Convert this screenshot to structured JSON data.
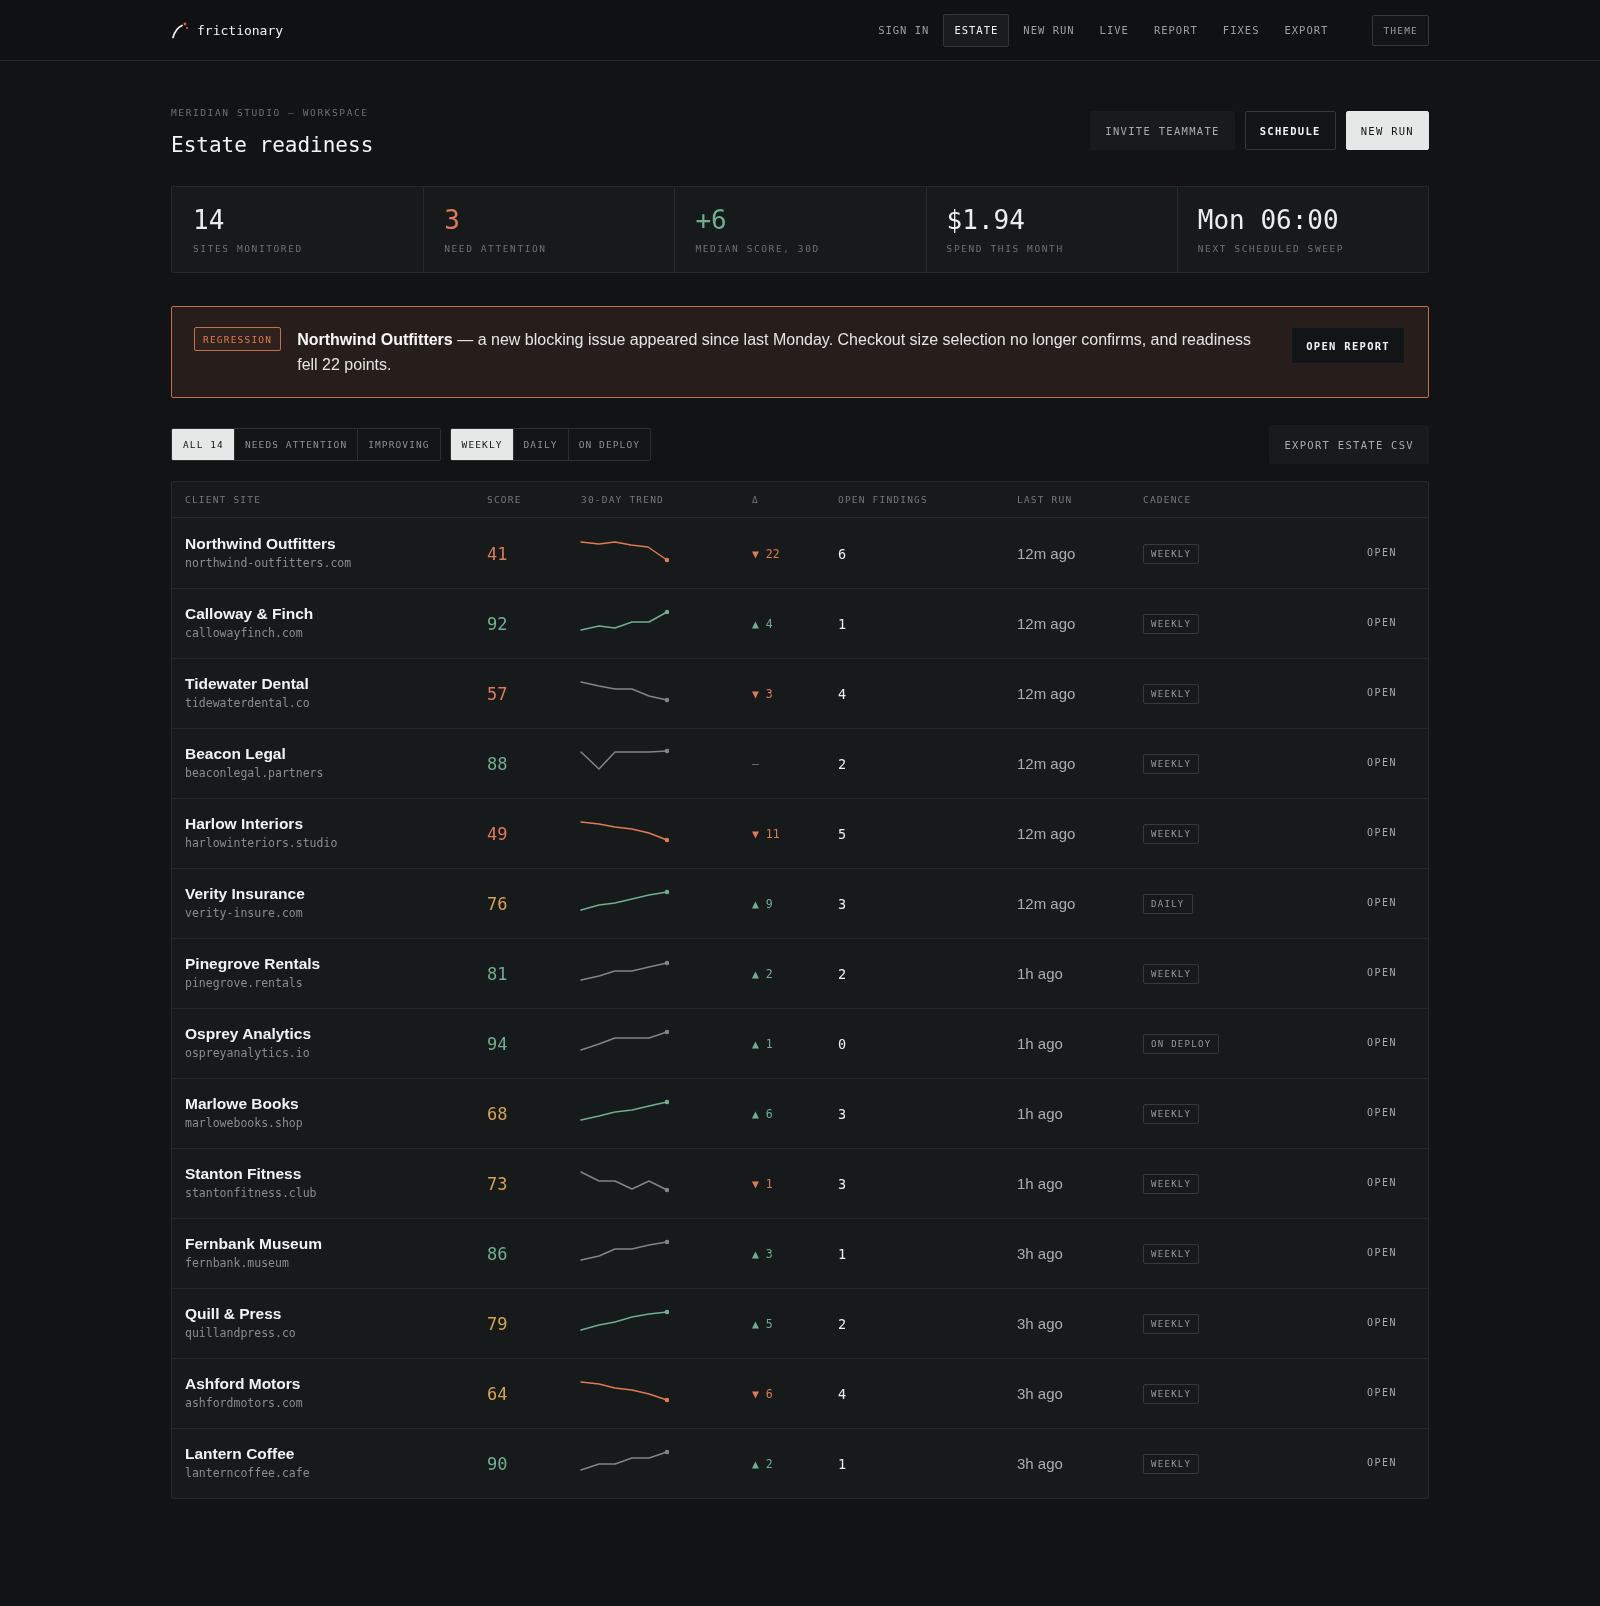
{
  "brand": {
    "name": "frictionary"
  },
  "nav": {
    "items": [
      {
        "label": "SIGN IN",
        "selected": false
      },
      {
        "label": "ESTATE",
        "selected": true
      },
      {
        "label": "NEW RUN",
        "selected": false
      },
      {
        "label": "LIVE",
        "selected": false
      },
      {
        "label": "REPORT",
        "selected": false
      },
      {
        "label": "FIXES",
        "selected": false
      },
      {
        "label": "EXPORT",
        "selected": false
      }
    ],
    "theme_button": "THEME"
  },
  "page": {
    "breadcrumb": "MERIDIAN STUDIO — WORKSPACE",
    "title": "Estate readiness",
    "actions": [
      {
        "label": "INVITE TEAMMATE",
        "kind": "subtle"
      },
      {
        "label": "SCHEDULE",
        "kind": "outline"
      },
      {
        "label": "NEW RUN",
        "kind": "primary"
      }
    ]
  },
  "stats": [
    {
      "value": "14",
      "label": "SITES MONITORED",
      "color": "#eceeed"
    },
    {
      "value": "3",
      "label": "NEED ATTENTION",
      "color": "#e07a52"
    },
    {
      "value": "+6",
      "label": "MEDIAN SCORE, 30D",
      "color": "#6fae8f"
    },
    {
      "value": "$1.94",
      "label": "SPEND THIS MONTH",
      "color": "#eceeed"
    },
    {
      "value": "Mon 06:00",
      "label": "NEXT SCHEDULED SWEEP",
      "color": "#eceeed"
    }
  ],
  "alert": {
    "badge": "REGRESSION",
    "message": "**Northwind Outfitters** — a new blocking issue appeared since last Monday. Checkout size selection no longer confirms, and readiness fell 22 points.",
    "action": "OPEN REPORT"
  },
  "status_filters": [
    {
      "label": "ALL 14",
      "selected": true
    },
    {
      "label": "NEEDS ATTENTION",
      "selected": false
    },
    {
      "label": "IMPROVING",
      "selected": false
    }
  ],
  "cadence_filters": [
    {
      "label": "WEEKLY",
      "selected": true
    },
    {
      "label": "DAILY",
      "selected": false
    },
    {
      "label": "ON DEPLOY",
      "selected": false
    }
  ],
  "export_button": "EXPORT ESTATE CSV",
  "table": {
    "columns": [
      "CLIENT SITE",
      "SCORE",
      "30-DAY TREND",
      "Δ",
      "OPEN FINDINGS",
      "LAST RUN",
      "CADENCE"
    ],
    "rows": [
      {
        "name": "Northwind Outfitters",
        "domain": "northwind-outfitters.com",
        "score": {
          "value": "41",
          "color": "#e07a52"
        },
        "trend": {
          "color": "#e07a52"
        },
        "delta": {
          "value": "▼ 22",
          "color": "#e07a52"
        },
        "open_findings": "6",
        "last_run": "12m ago",
        "cadence": "WEEKLY",
        "action": "OPEN"
      },
      {
        "name": "Calloway & Finch",
        "domain": "callowayfinch.com",
        "score": {
          "value": "92",
          "color": "#6fae8f"
        },
        "trend": {
          "color": "#6fae8f"
        },
        "delta": {
          "value": "▲ 4",
          "color": "#6fae8f"
        },
        "open_findings": "1",
        "last_run": "12m ago",
        "cadence": "WEEKLY",
        "action": "OPEN"
      },
      {
        "name": "Tidewater Dental",
        "domain": "tidewaterdental.co",
        "score": {
          "value": "57",
          "color": "#e07a52"
        },
        "trend": {
          "color": "#7f8683"
        },
        "delta": {
          "value": "▼ 3",
          "color": "#e07a52"
        },
        "open_findings": "4",
        "last_run": "12m ago",
        "cadence": "WEEKLY",
        "action": "OPEN"
      },
      {
        "name": "Beacon Legal",
        "domain": "beaconlegal.partners",
        "score": {
          "value": "88",
          "color": "#6fae8f"
        },
        "trend": {
          "color": "#7f8683"
        },
        "delta": {
          "value": "–",
          "color": "#6f7673"
        },
        "open_findings": "2",
        "last_run": "12m ago",
        "cadence": "WEEKLY",
        "action": "OPEN"
      },
      {
        "name": "Harlow Interiors",
        "domain": "harlowinteriors.studio",
        "score": {
          "value": "49",
          "color": "#e07a52"
        },
        "trend": {
          "color": "#e07a52"
        },
        "delta": {
          "value": "▼ 11",
          "color": "#e07a52"
        },
        "open_findings": "5",
        "last_run": "12m ago",
        "cadence": "WEEKLY",
        "action": "OPEN"
      },
      {
        "name": "Verity Insurance",
        "domain": "verity-insure.com",
        "score": {
          "value": "76",
          "color": "#d6a24e"
        },
        "trend": {
          "color": "#6fae8f"
        },
        "delta": {
          "value": "▲ 9",
          "color": "#6fae8f"
        },
        "open_findings": "3",
        "last_run": "12m ago",
        "cadence": "DAILY",
        "action": "OPEN"
      },
      {
        "name": "Pinegrove Rentals",
        "domain": "pinegrove.rentals",
        "score": {
          "value": "81",
          "color": "#6fae8f"
        },
        "trend": {
          "color": "#7f8683"
        },
        "delta": {
          "value": "▲ 2",
          "color": "#6fae8f"
        },
        "open_findings": "2",
        "last_run": "1h ago",
        "cadence": "WEEKLY",
        "action": "OPEN"
      },
      {
        "name": "Osprey Analytics",
        "domain": "ospreyanalytics.io",
        "score": {
          "value": "94",
          "color": "#6fae8f"
        },
        "trend": {
          "color": "#7f8683"
        },
        "delta": {
          "value": "▲ 1",
          "color": "#6fae8f"
        },
        "open_findings": "0",
        "last_run": "1h ago",
        "cadence": "ON DEPLOY",
        "action": "OPEN"
      },
      {
        "name": "Marlowe Books",
        "domain": "marlowebooks.shop",
        "score": {
          "value": "68",
          "color": "#d6a24e"
        },
        "trend": {
          "color": "#6fae8f"
        },
        "delta": {
          "value": "▲ 6",
          "color": "#6fae8f"
        },
        "open_findings": "3",
        "last_run": "1h ago",
        "cadence": "WEEKLY",
        "action": "OPEN"
      },
      {
        "name": "Stanton Fitness",
        "domain": "stantonfitness.club",
        "score": {
          "value": "73",
          "color": "#d6a24e"
        },
        "trend": {
          "color": "#7f8683"
        },
        "delta": {
          "value": "▼ 1",
          "color": "#e07a52"
        },
        "open_findings": "3",
        "last_run": "1h ago",
        "cadence": "WEEKLY",
        "action": "OPEN"
      },
      {
        "name": "Fernbank Museum",
        "domain": "fernbank.museum",
        "score": {
          "value": "86",
          "color": "#6fae8f"
        },
        "trend": {
          "color": "#7f8683"
        },
        "delta": {
          "value": "▲ 3",
          "color": "#6fae8f"
        },
        "open_findings": "1",
        "last_run": "3h ago",
        "cadence": "WEEKLY",
        "action": "OPEN"
      },
      {
        "name": "Quill & Press",
        "domain": "quillandpress.co",
        "score": {
          "value": "79",
          "color": "#d6a24e"
        },
        "trend": {
          "color": "#6fae8f"
        },
        "delta": {
          "value": "▲ 5",
          "color": "#6fae8f"
        },
        "open_findings": "2",
        "last_run": "3h ago",
        "cadence": "WEEKLY",
        "action": "OPEN"
      },
      {
        "name": "Ashford Motors",
        "domain": "ashfordmotors.com",
        "score": {
          "value": "64",
          "color": "#d6a24e"
        },
        "trend": {
          "color": "#e07a52"
        },
        "delta": {
          "value": "▼ 6",
          "color": "#e07a52"
        },
        "open_findings": "4",
        "last_run": "3h ago",
        "cadence": "WEEKLY",
        "action": "OPEN"
      },
      {
        "name": "Lantern Coffee",
        "domain": "lanterncoffee.cafe",
        "score": {
          "value": "90",
          "color": "#6fae8f"
        },
        "trend": {
          "color": "#7f8683"
        },
        "delta": {
          "value": "▲ 2",
          "color": "#6fae8f"
        },
        "open_findings": "1",
        "last_run": "3h ago",
        "cadence": "WEEKLY",
        "action": "OPEN"
      }
    ]
  }
}
